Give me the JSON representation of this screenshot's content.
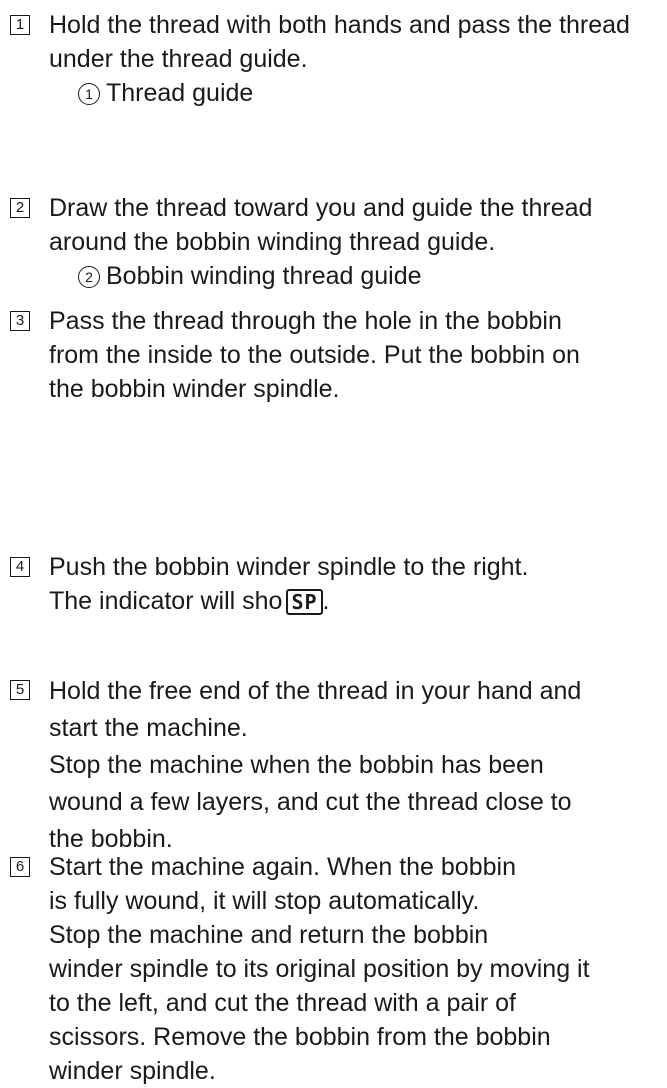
{
  "steps": [
    {
      "num": "1",
      "lines": [
        "Hold the thread with both hands and pass the thread",
        "under the thread guide."
      ],
      "sub": {
        "marker": "1",
        "label": "Thread guide"
      }
    },
    {
      "num": "2",
      "lines": [
        "Draw the thread toward you and guide the thread",
        "around the bobbin winding thread guide."
      ],
      "sub": {
        "marker": "2",
        "label": "Bobbin winding thread guide"
      }
    },
    {
      "num": "3",
      "lines": [
        "Pass the thread through the hole in the bobbin",
        "from the inside to the outside. Put the bobbin on",
        "the bobbin winder spindle."
      ]
    },
    {
      "num": "4",
      "lines": [
        "Push the bobbin winder spindle to the right.",
        "The indicator will sho"
      ],
      "indicator": "SP",
      "suffix": "."
    },
    {
      "num": "5",
      "lines": [
        "Hold the free end of the thread in your hand and",
        "start the machine.",
        "Stop the machine when the bobbin has been",
        "wound a few layers, and cut the thread close to",
        "the bobbin."
      ]
    },
    {
      "num": "6",
      "lines": [
        "Start the machine again. When the bobbin",
        "is fully wound, it will stop automatically.",
        "Stop the machine and return the bobbin",
        "winder spindle to its original position by moving it",
        "to the left, and cut the thread with a pair of",
        "scissors. Remove the bobbin from the bobbin",
        "winder spindle."
      ]
    }
  ]
}
